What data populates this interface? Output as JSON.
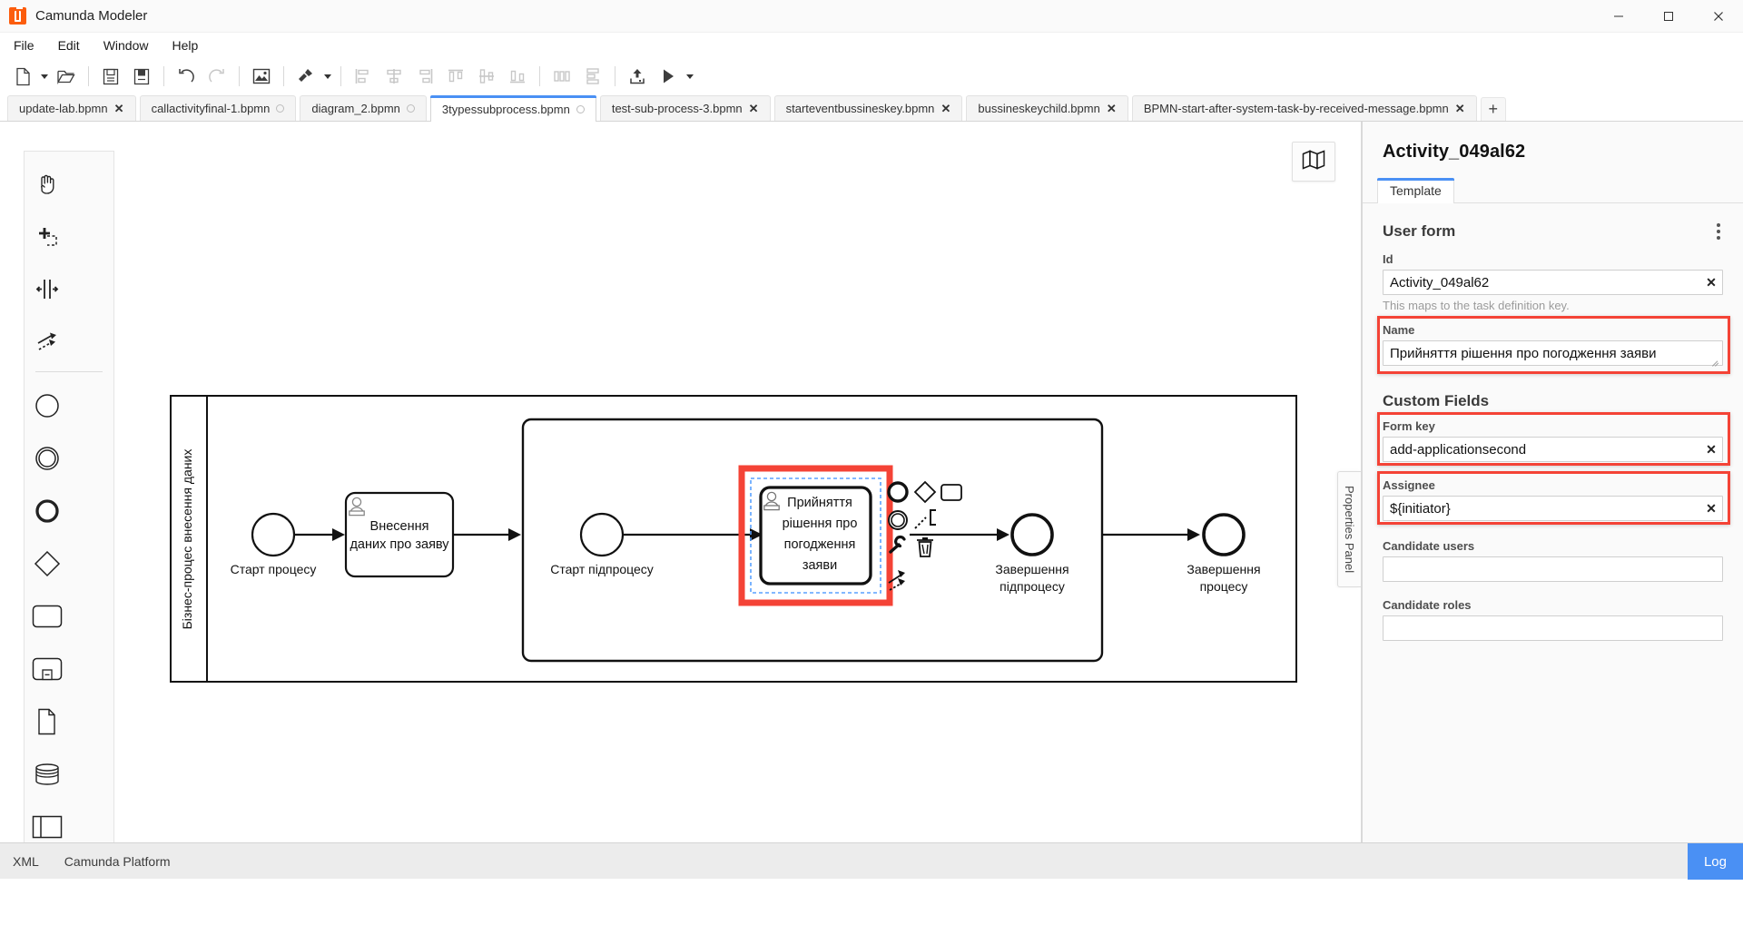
{
  "window": {
    "title": "Camunda Modeler",
    "app_icon": "camunda-icon",
    "minimize": "minimize-icon",
    "maximize": "maximize-icon",
    "close": "close-icon"
  },
  "menubar": {
    "items": [
      "File",
      "Edit",
      "Window",
      "Help"
    ]
  },
  "toolbar": {
    "buttons": [
      {
        "name": "new-diagram-icon",
        "disabled": false
      },
      {
        "name": "new-diagram-caret",
        "caret": true
      },
      {
        "name": "open-folder-icon",
        "disabled": false
      },
      {
        "name": "separator",
        "sep": true
      },
      {
        "name": "save-icon",
        "disabled": false
      },
      {
        "name": "save-as-icon",
        "disabled": false
      },
      {
        "name": "separator",
        "sep": true
      },
      {
        "name": "undo-icon",
        "disabled": false
      },
      {
        "name": "redo-icon",
        "disabled": true
      },
      {
        "name": "separator",
        "sep": true
      },
      {
        "name": "export-image-icon",
        "disabled": false
      },
      {
        "name": "separator",
        "sep": true
      },
      {
        "name": "align-tool-icon",
        "disabled": false
      },
      {
        "name": "align-tool-caret",
        "caret": true
      },
      {
        "name": "separator",
        "sep": true
      },
      {
        "name": "align-left-icon",
        "disabled": true
      },
      {
        "name": "align-center-horizontal-icon",
        "disabled": true
      },
      {
        "name": "align-right-icon",
        "disabled": true
      },
      {
        "name": "align-top-icon",
        "disabled": true
      },
      {
        "name": "align-middle-icon",
        "disabled": true
      },
      {
        "name": "align-bottom-icon",
        "disabled": true
      },
      {
        "name": "separator",
        "sep": true
      },
      {
        "name": "distribute-horizontal-icon",
        "disabled": true
      },
      {
        "name": "distribute-vertical-icon",
        "disabled": true
      },
      {
        "name": "separator",
        "sep": true
      },
      {
        "name": "deploy-icon",
        "disabled": false
      },
      {
        "name": "start-process-icon",
        "disabled": false
      },
      {
        "name": "start-process-caret",
        "caret": true
      }
    ]
  },
  "tabs": {
    "items": [
      {
        "label": "update-lab.bpmn",
        "state": "close",
        "active": false
      },
      {
        "label": "callactivityfinal-1.bpmn",
        "state": "dirty",
        "active": false
      },
      {
        "label": "diagram_2.bpmn",
        "state": "dirty",
        "active": false
      },
      {
        "label": "3typessubprocess.bpmn",
        "state": "dirty",
        "active": true
      },
      {
        "label": "test-sub-process-3.bpmn",
        "state": "close",
        "active": false
      },
      {
        "label": "starteventbussineskey.bpmn",
        "state": "close",
        "active": false
      },
      {
        "label": "bussineskeychild.bpmn",
        "state": "close",
        "active": false
      },
      {
        "label": "BPMN-start-after-system-task-by-received-message.bpmn",
        "state": "close",
        "active": false
      }
    ],
    "add_label": "+",
    "close_glyph": "✕"
  },
  "palette": {
    "tools": [
      {
        "name": "hand-tool-icon"
      },
      {
        "name": "lasso-tool-icon"
      },
      {
        "name": "space-tool-icon"
      },
      {
        "name": "global-connect-tool-icon"
      }
    ],
    "elements": [
      {
        "name": "start-event-icon"
      },
      {
        "name": "intermediate-event-icon"
      },
      {
        "name": "end-event-icon"
      },
      {
        "name": "exclusive-gateway-icon"
      },
      {
        "name": "task-icon"
      },
      {
        "name": "subprocess-collapsed-icon"
      },
      {
        "name": "data-object-icon"
      },
      {
        "name": "data-store-icon"
      },
      {
        "name": "participant-pool-icon"
      },
      {
        "name": "create-group-icon"
      }
    ]
  },
  "canvas": {
    "minimap_icon": "map-icon",
    "properties_panel_tab": "Properties Panel",
    "pool_label": "Бізнес-процес внесення даних",
    "elements": [
      {
        "type": "start-event",
        "label": "Старт процесу"
      },
      {
        "type": "user-task",
        "label": "Внесення\nданих про заяву"
      },
      {
        "type": "start-event",
        "label": "Старт підпроцесу"
      },
      {
        "type": "user-task-selected",
        "label": "Прийняття\nрішення про\nпогодження\nзаяви"
      },
      {
        "type": "end-event",
        "label": "Завершення\nпідпроцесу"
      },
      {
        "type": "end-event",
        "label": "Завершення\nпроцесу"
      }
    ],
    "context_pad": [
      {
        "name": "append-end-event-icon"
      },
      {
        "name": "append-gateway-icon"
      },
      {
        "name": "append-task-icon"
      },
      {
        "name": "append-intermediate-event-icon"
      },
      {
        "name": "append-text-annotation-icon"
      },
      {
        "name": "change-type-wrench-icon"
      },
      {
        "name": "delete-trash-icon"
      },
      {
        "name": "connect-tool-icon"
      }
    ]
  },
  "properties": {
    "element_id_title": "Activity_049al62",
    "tabs": [
      {
        "label": "Template",
        "active": true
      }
    ],
    "group_user_form": {
      "title": "User form",
      "kebab": "more-options-icon",
      "fields": [
        {
          "key": "id",
          "label": "Id",
          "value": "Activity_049al62",
          "hint": "This maps to the task definition key.",
          "clearable": true,
          "highlight": false
        },
        {
          "key": "name",
          "label": "Name",
          "value": "Прийняття рішення про погодження заяви",
          "hint": "",
          "clearable": false,
          "highlight": true,
          "textarea": true
        }
      ]
    },
    "group_custom_fields": {
      "title": "Custom Fields",
      "fields": [
        {
          "key": "form_key",
          "label": "Form key",
          "value": "add-applicationsecond",
          "clearable": true,
          "highlight": true
        },
        {
          "key": "assignee",
          "label": "Assignee",
          "value": "${initiator}",
          "clearable": true,
          "highlight": true
        },
        {
          "key": "candidate_users",
          "label": "Candidate users",
          "value": "",
          "clearable": false,
          "highlight": false
        },
        {
          "key": "candidate_roles",
          "label": "Candidate roles",
          "value": "",
          "clearable": false,
          "highlight": false
        }
      ]
    }
  },
  "footer": {
    "items": [
      "XML",
      "Camunda Platform"
    ],
    "log_label": "Log"
  },
  "colors": {
    "accent": "#4a90f4",
    "highlight": "#f44336",
    "brand": "#fc5d0d",
    "footer_bg": "#ececec"
  }
}
